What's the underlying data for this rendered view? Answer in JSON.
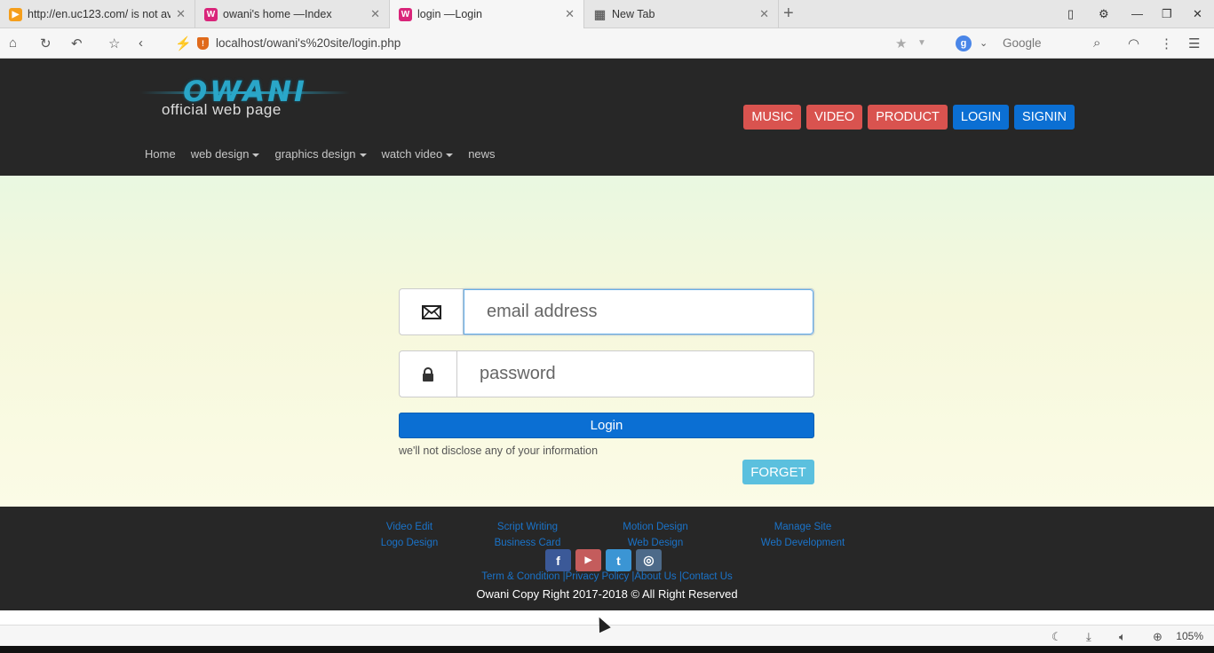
{
  "browser": {
    "tabs": [
      {
        "label": "http://en.uc123.com/ is not av",
        "icon_color": "#f59e1b",
        "icon_glyph": "▶"
      },
      {
        "label": "owani's home —Index",
        "icon_color": "#d9257a",
        "icon_glyph": "W"
      },
      {
        "label": "login —Login",
        "icon_color": "#d9257a",
        "icon_glyph": "W"
      },
      {
        "label": "New Tab",
        "icon_color": "#666666",
        "icon_glyph": "▦"
      }
    ],
    "url": "localhost/owani's%20site/login.php",
    "search_engine_letter": "g",
    "search_placeholder": "Google",
    "zoom": "105%"
  },
  "site": {
    "logo_title": "OWANI",
    "logo_subtitle": "official web page",
    "top_buttons": [
      {
        "label": "MUSIC",
        "color": "#d9534f"
      },
      {
        "label": "VIDEO",
        "color": "#d9534f"
      },
      {
        "label": "PRODUCT",
        "color": "#d9534f"
      },
      {
        "label": "LOGIN",
        "color": "#0b6fd3"
      },
      {
        "label": "SIGNIN",
        "color": "#0b6fd3"
      }
    ],
    "nav": [
      {
        "label": "Home"
      },
      {
        "label": "web design"
      },
      {
        "label": "graphics design"
      },
      {
        "label": "watch video"
      },
      {
        "label": "news"
      }
    ]
  },
  "login_form": {
    "email_placeholder": "email address",
    "password_placeholder": "password",
    "login_label": "Login",
    "disclaimer": "we'll not disclose any of your information",
    "forget_label": "FORGET"
  },
  "footer": {
    "columns": [
      [
        "Video Edit",
        "Logo Design"
      ],
      [
        "Script Writing",
        "Business Card"
      ],
      [
        "Motion Design",
        "Web Design"
      ],
      [
        "Manage Site",
        "Web Development"
      ]
    ],
    "social": [
      {
        "name": "facebook-icon",
        "glyph": "f",
        "color": "#3b5998"
      },
      {
        "name": "youtube-icon",
        "glyph": "▶",
        "color": "#c45c5c"
      },
      {
        "name": "twitter-icon",
        "glyph": "t",
        "color": "#3b95d4"
      },
      {
        "name": "instagram-icon",
        "glyph": "◎",
        "color": "#4d6a89"
      }
    ],
    "links": "Term & Condition |Privacy Policy |About Us |Contact Us",
    "copyright": "Owani Copy Right 2017-2018 © All Right Reserved"
  }
}
